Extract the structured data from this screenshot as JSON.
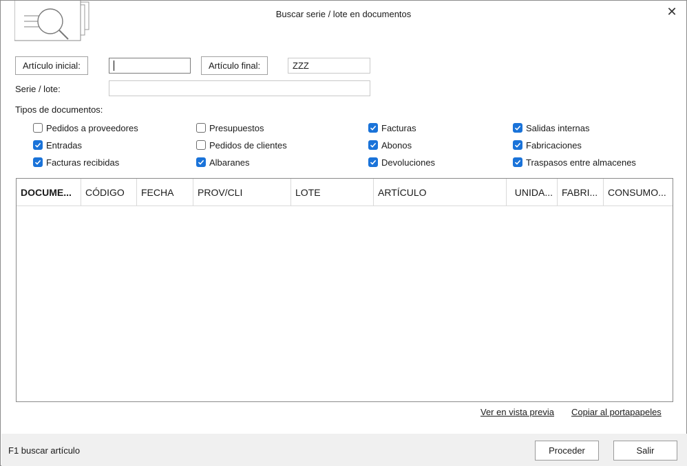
{
  "window": {
    "title": "Buscar serie / lote en documentos",
    "close_symbol": "✕"
  },
  "icons": {
    "header": "document-search-icon",
    "close": "close-icon",
    "checkmark": "checkmark-icon"
  },
  "colors": {
    "accent": "#1a73d9",
    "footer_bg": "#f0f0f0"
  },
  "filters": {
    "articulo_inicial_label": "Artículo inicial:",
    "articulo_inicial_value": "",
    "articulo_final_label": "Artículo final:",
    "articulo_final_value": "ZZZ",
    "serie_lote_label": "Serie / lote:",
    "serie_lote_value": ""
  },
  "tipos": {
    "heading": "Tipos de documentos:",
    "items": [
      {
        "label": "Pedidos a proveedores",
        "checked": false
      },
      {
        "label": "Entradas",
        "checked": true
      },
      {
        "label": "Facturas recibidas",
        "checked": true
      },
      {
        "label": "Presupuestos",
        "checked": false
      },
      {
        "label": "Pedidos de clientes",
        "checked": false
      },
      {
        "label": "Albaranes",
        "checked": true
      },
      {
        "label": "Facturas",
        "checked": true
      },
      {
        "label": "Abonos",
        "checked": true
      },
      {
        "label": "Devoluciones",
        "checked": true
      },
      {
        "label": "Salidas internas",
        "checked": true
      },
      {
        "label": "Fabricaciones",
        "checked": true
      },
      {
        "label": "Traspasos entre almacenes",
        "checked": true
      }
    ]
  },
  "grid": {
    "columns": [
      "DOCUME...",
      "CÓDIGO",
      "FECHA",
      "PROV/CLI",
      "LOTE",
      "ARTÍCULO",
      "UNIDA...",
      "FABRI...",
      "CONSUMO..."
    ],
    "rows": []
  },
  "links": {
    "preview": "Ver en vista previa",
    "clipboard": "Copiar al portapapeles"
  },
  "footer": {
    "status": "F1 buscar artículo",
    "proceed": "Proceder",
    "exit": "Salir"
  }
}
